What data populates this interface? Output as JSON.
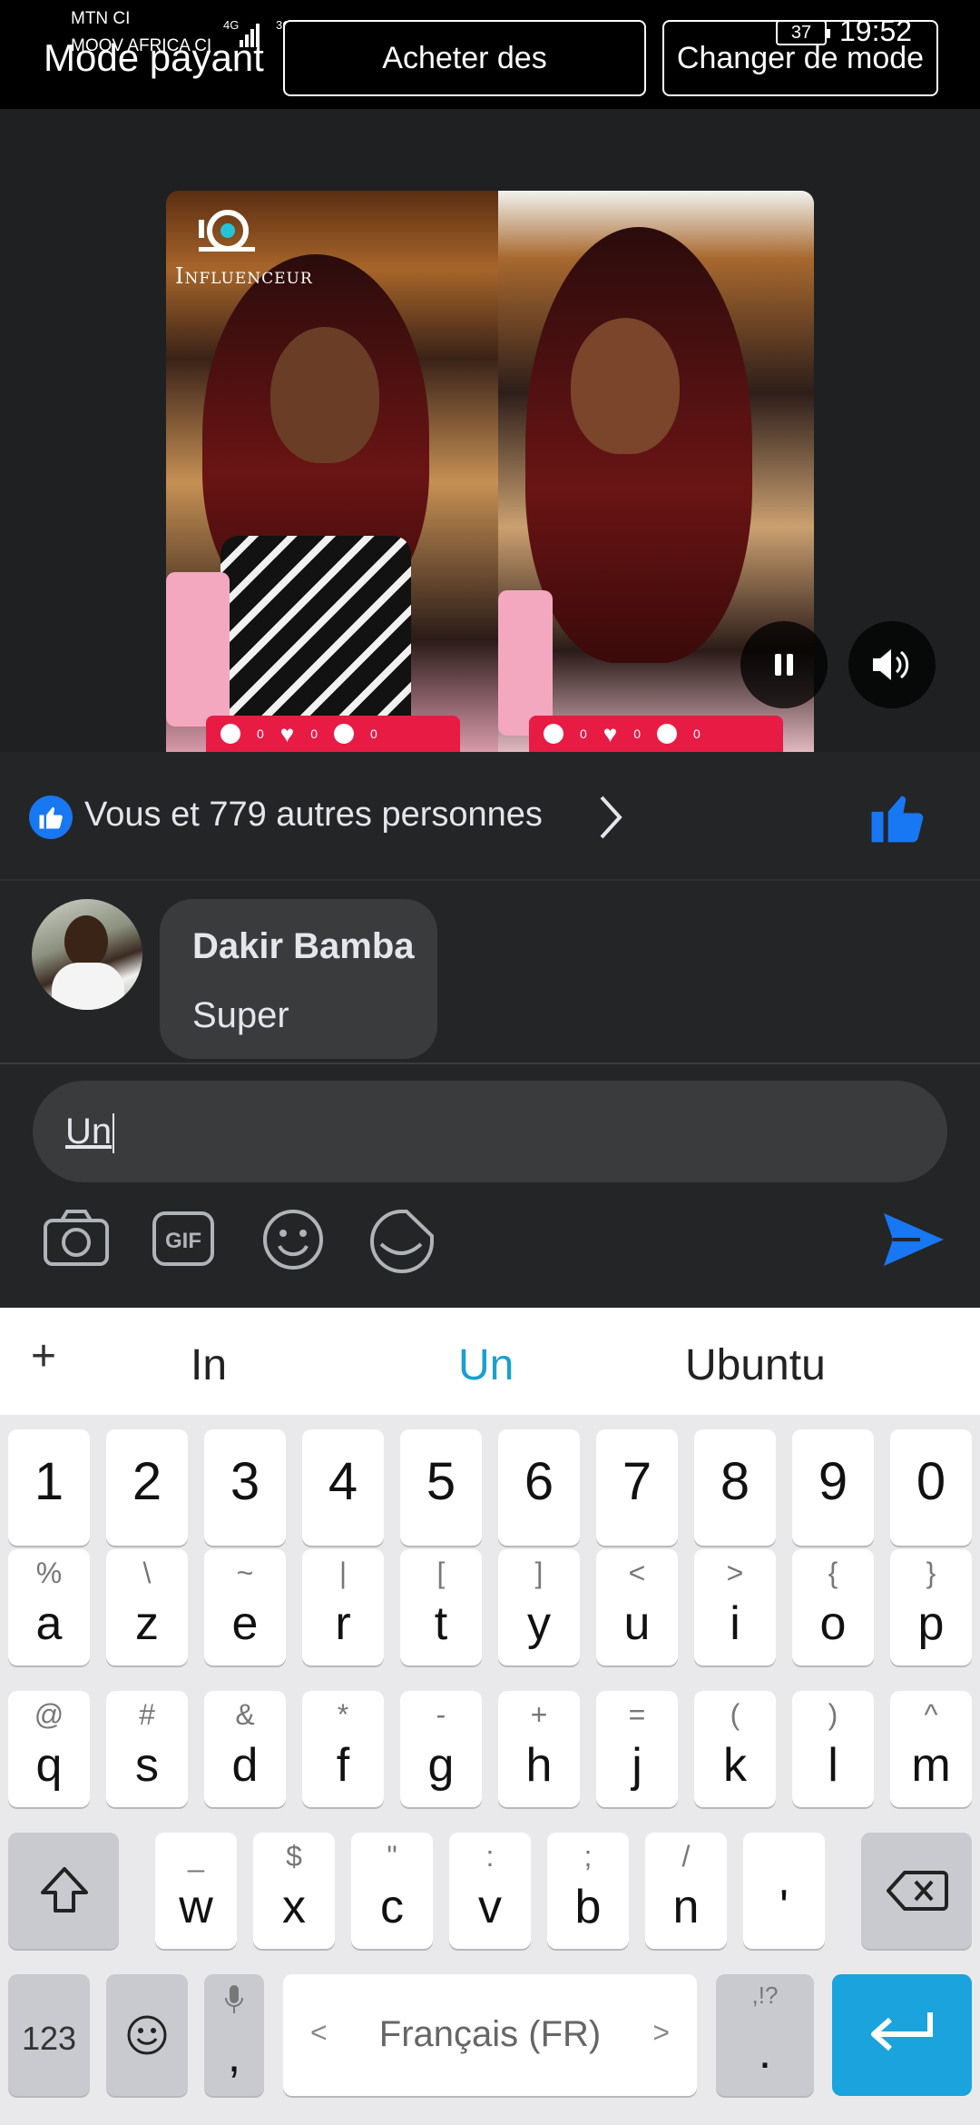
{
  "status_bar": {
    "carrier_1": "MTN CI",
    "carrier_2": "MOOV AFRICA CI",
    "battery": "37",
    "time": "19:52"
  },
  "header": {
    "mode_label": "Mode payant",
    "buy_button": "Acheter des",
    "change_mode_button": "Changer de mode"
  },
  "video": {
    "brand_text": "NFLUENCEUR",
    "reaction_counts_left": [
      "0",
      "0",
      "0"
    ],
    "reaction_counts_right": [
      "0",
      "0",
      "0"
    ]
  },
  "likes": {
    "text": "Vous et 779 autres personnes"
  },
  "comment": {
    "author": "Dakir Bamba",
    "text": "Super"
  },
  "composer": {
    "input_value": "Un"
  },
  "keyboard": {
    "suggestions": [
      "In",
      "Un",
      "Ubuntu"
    ],
    "digits": [
      "1",
      "2",
      "3",
      "4",
      "5",
      "6",
      "7",
      "8",
      "9",
      "0"
    ],
    "row1": [
      [
        "%",
        "a"
      ],
      [
        "\\",
        "z"
      ],
      [
        "~",
        "e"
      ],
      [
        "|",
        "r"
      ],
      [
        "[",
        "t"
      ],
      [
        "]",
        "y"
      ],
      [
        "<",
        "u"
      ],
      [
        ">",
        "i"
      ],
      [
        "{",
        "o"
      ],
      [
        "}",
        "p"
      ]
    ],
    "row2": [
      [
        "@",
        "q"
      ],
      [
        "#",
        "s"
      ],
      [
        "&",
        "d"
      ],
      [
        "*",
        "f"
      ],
      [
        "-",
        "g"
      ],
      [
        "+",
        "h"
      ],
      [
        "=",
        "j"
      ],
      [
        "(",
        "k"
      ],
      [
        ")",
        "l"
      ],
      [
        "^",
        "m"
      ]
    ],
    "row3": [
      [
        "_",
        "w"
      ],
      [
        "$",
        "x"
      ],
      [
        "\"",
        "c"
      ],
      [
        ":",
        "v"
      ],
      [
        ";",
        "b"
      ],
      [
        "/",
        "n"
      ],
      [
        "",
        "'"
      ]
    ],
    "num_key": "123",
    "comma_key": ",",
    "space_key": "Français (FR)",
    "period_key": ".",
    "period_sub": ",!?"
  },
  "colors": {
    "accent_blue": "#1877f2",
    "keyboard_enter": "#1aa3dc",
    "suggestion_highlight": "#18a0d0"
  }
}
